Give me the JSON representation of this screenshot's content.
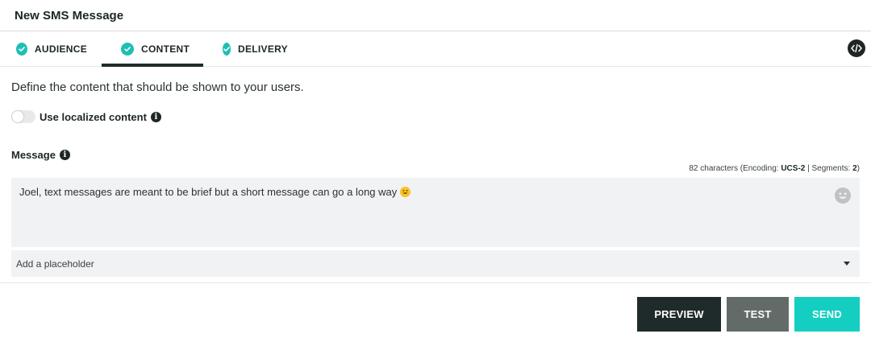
{
  "header": {
    "title": "New SMS Message"
  },
  "tabs": [
    {
      "label": "AUDIENCE",
      "complete": true
    },
    {
      "label": "CONTENT",
      "complete": true,
      "active": true
    },
    {
      "label": "DELIVERY",
      "complete": true
    }
  ],
  "content": {
    "intro": "Define the content that should be shown to your users.",
    "localized_label": "Use localized content",
    "localized_enabled": false,
    "message_label": "Message",
    "counter": {
      "prefix": "82 characters (Encoding: ",
      "encoding": "UCS-2",
      "middle": " | Segments: ",
      "segments": "2",
      "suffix": ")"
    },
    "message_text": "Joel, text messages are meant to be brief but a short message can go a long way",
    "placeholder_select": "Add a placeholder"
  },
  "actions": {
    "preview": "PREVIEW",
    "test": "TEST",
    "send": "SEND"
  },
  "colors": {
    "accent": "#1dbfb3",
    "send": "#14cfc1",
    "dark": "#1f2a2a",
    "test": "#636b69"
  }
}
